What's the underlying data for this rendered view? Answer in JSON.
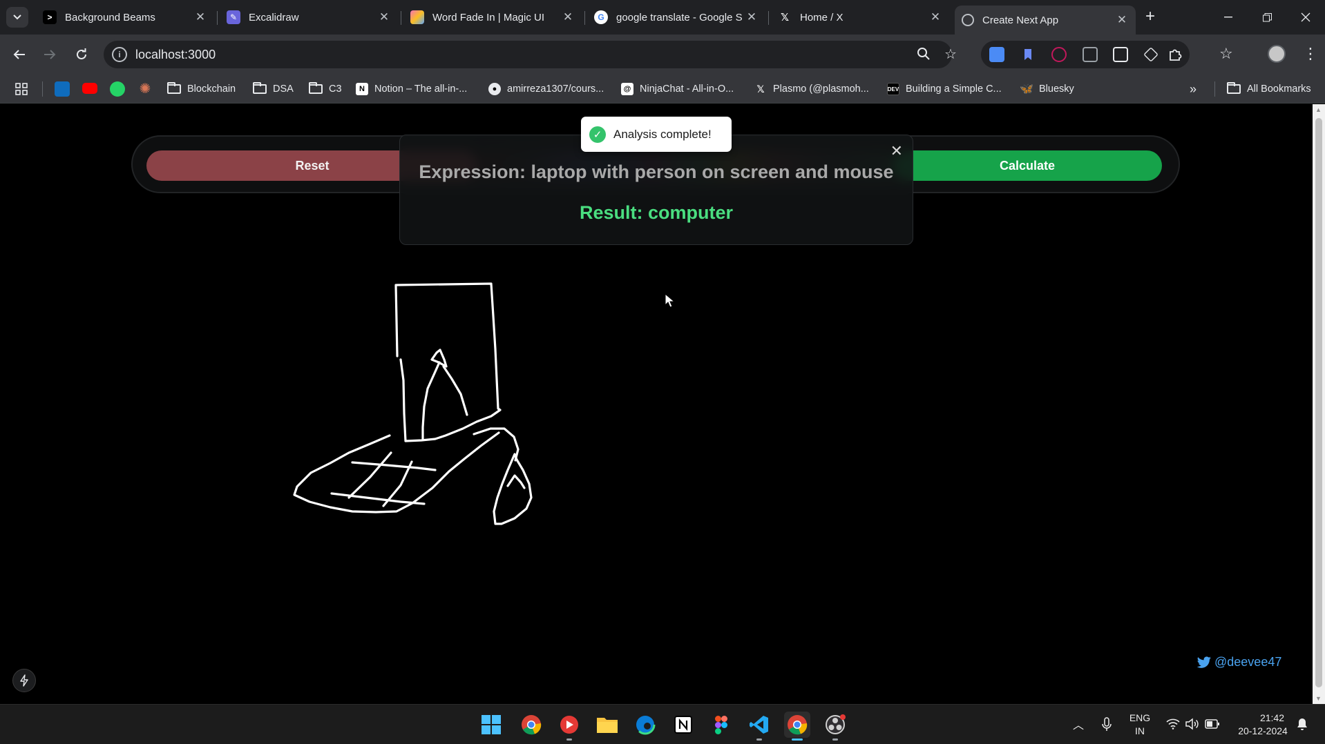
{
  "browser": {
    "tabs": [
      {
        "title": "Background Beams",
        "favicon": ">"
      },
      {
        "title": "Excalidraw",
        "favicon": "X"
      },
      {
        "title": "Word Fade In | Magic UI",
        "favicon": ""
      },
      {
        "title": "google translate - Google S",
        "favicon": "G"
      },
      {
        "title": "Home / X",
        "favicon": "X"
      },
      {
        "title": "Create Next App",
        "favicon": ""
      }
    ],
    "active_tab_index": 5,
    "url": "localhost:3000",
    "bookmarks": [
      {
        "label": "Blockchain",
        "type": "folder"
      },
      {
        "label": "DSA",
        "type": "folder"
      },
      {
        "label": "C3",
        "type": "folder"
      },
      {
        "label": "Notion – The all-in-...",
        "type": "link"
      },
      {
        "label": "amirreza1307/cours...",
        "type": "link"
      },
      {
        "label": "NinjaChat - All-in-O...",
        "type": "link"
      },
      {
        "label": "Plasmo (@plasmoh...",
        "type": "link"
      },
      {
        "label": "Building a Simple C...",
        "type": "link"
      },
      {
        "label": "Bluesky",
        "type": "link"
      }
    ],
    "all_bookmarks_label": "All Bookmarks"
  },
  "app": {
    "reset_label": "Reset",
    "calculate_label": "Calculate",
    "toast_message": "Analysis complete!",
    "expression_text": "Expression: laptop with person on screen and mouse",
    "result_text": "Result: computer",
    "twitter_handle": "@deevee47",
    "colors": {
      "reset": "#8b4247",
      "calculate": "#16a34a",
      "result": "#4ade80"
    }
  },
  "taskbar": {
    "language_line1": "ENG",
    "language_line2": "IN",
    "time": "21:42",
    "date": "20-12-2024"
  }
}
